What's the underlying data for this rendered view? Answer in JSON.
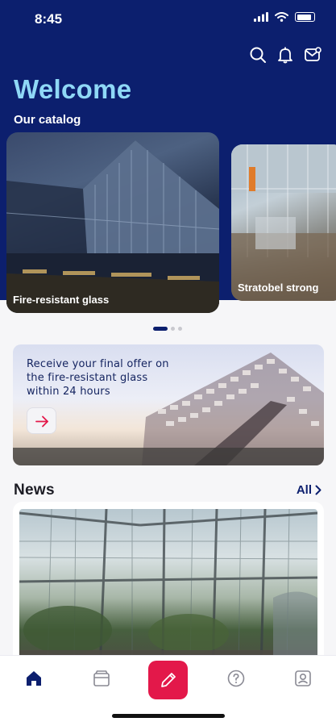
{
  "status_bar": {
    "time": "8:45",
    "icons": [
      "signal-icon",
      "wifi-icon",
      "battery-icon"
    ]
  },
  "header": {
    "actions": [
      "search-icon",
      "bell-icon",
      "mail-icon"
    ],
    "title": "Welcome",
    "subtitle": "Our catalog"
  },
  "catalog": {
    "items": [
      {
        "label": "Fire-resistant glass"
      },
      {
        "label": "Stratobel strong"
      }
    ],
    "pager": {
      "count": 3,
      "active": 0
    }
  },
  "banner": {
    "text": "Receive your final offer on the fire-resistant glass within 24 hours",
    "button_icon": "arrow-right-icon"
  },
  "news": {
    "title": "News",
    "all_label": "All"
  },
  "tabbar": {
    "items": [
      "home-icon",
      "catalog-box-icon",
      "pencil-icon",
      "help-icon",
      "profile-icon"
    ],
    "active": "home-icon"
  },
  "colors": {
    "brand_navy": "#0c1f6e",
    "accent_cyan": "#8fd8f6",
    "accent_red": "#e3184a"
  }
}
